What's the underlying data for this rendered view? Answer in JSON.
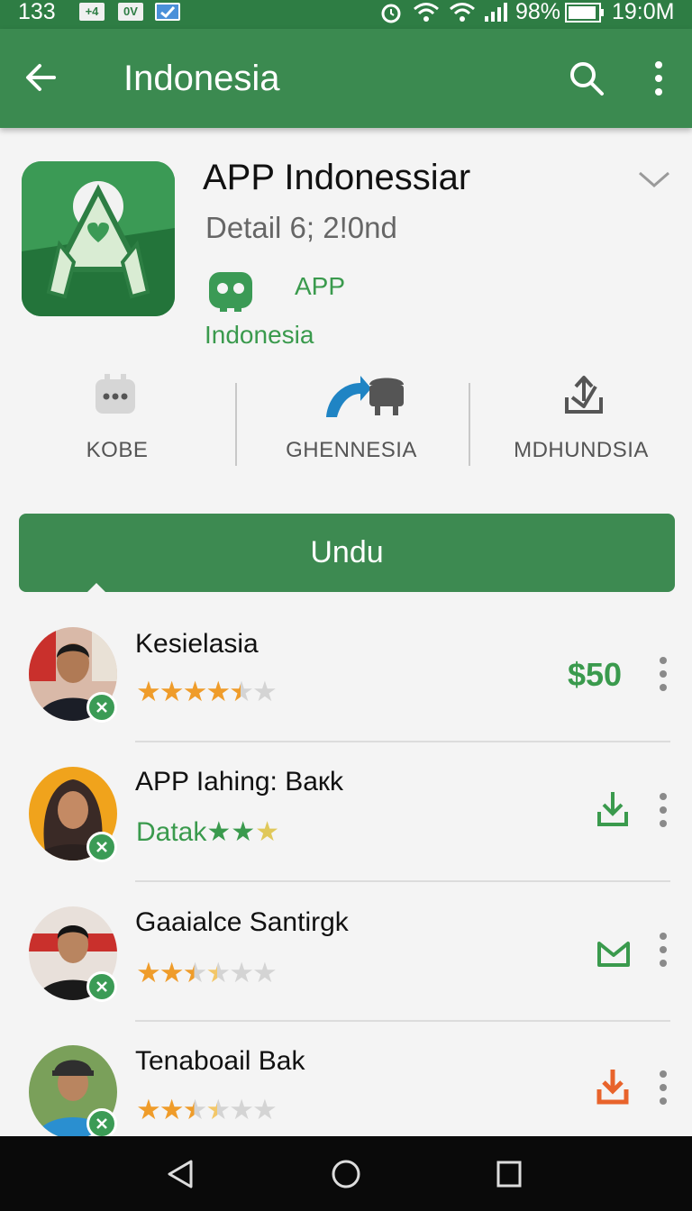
{
  "status_bar": {
    "left_number": "133",
    "box1": "+4",
    "box2": "0V",
    "battery": "98%",
    "time": "19:0M"
  },
  "app_bar": {
    "title": "Indonesia",
    "back_icon": "arrow-left-icon",
    "search_icon": "search-icon",
    "more_icon": "more-vertical-icon"
  },
  "app": {
    "title": "APP Indonessiar",
    "subtitle": "Detail 6; 2!0nd",
    "publisher_line1": "APP",
    "publisher_line2": "Indonesia"
  },
  "stats": [
    {
      "label": "KOBE",
      "icon": "chat-bubble-icon"
    },
    {
      "label": "GHENNESIA",
      "icon": "android-icon"
    },
    {
      "label": "MDHUNDSIA",
      "icon": "upload-icon"
    }
  ],
  "install_label": "Undu",
  "list": [
    {
      "name": "Kesielasia",
      "rating": 4.5,
      "action": "$50",
      "action_icon": ""
    },
    {
      "name": "APP Iahing: Baкk",
      "prefix": "Datak",
      "rating": 3,
      "action": "",
      "action_icon": "download-icon"
    },
    {
      "name": "Gaaialce Santirgk",
      "rating": 3.5,
      "action": "",
      "action_icon": "mail-icon"
    },
    {
      "name": "Tenaboail Bak",
      "rating": 3.5,
      "action": "",
      "action_icon": "download-orange-icon"
    }
  ],
  "colors": {
    "primary": "#3b8a50",
    "status": "#2e7d44",
    "accent_text": "#3a9a4d",
    "star": "#ef9c2a",
    "orange_action": "#e8632b"
  },
  "nav": {
    "back_icon": "nav-back-icon",
    "home_icon": "nav-home-icon",
    "recents_icon": "nav-recents-icon"
  }
}
